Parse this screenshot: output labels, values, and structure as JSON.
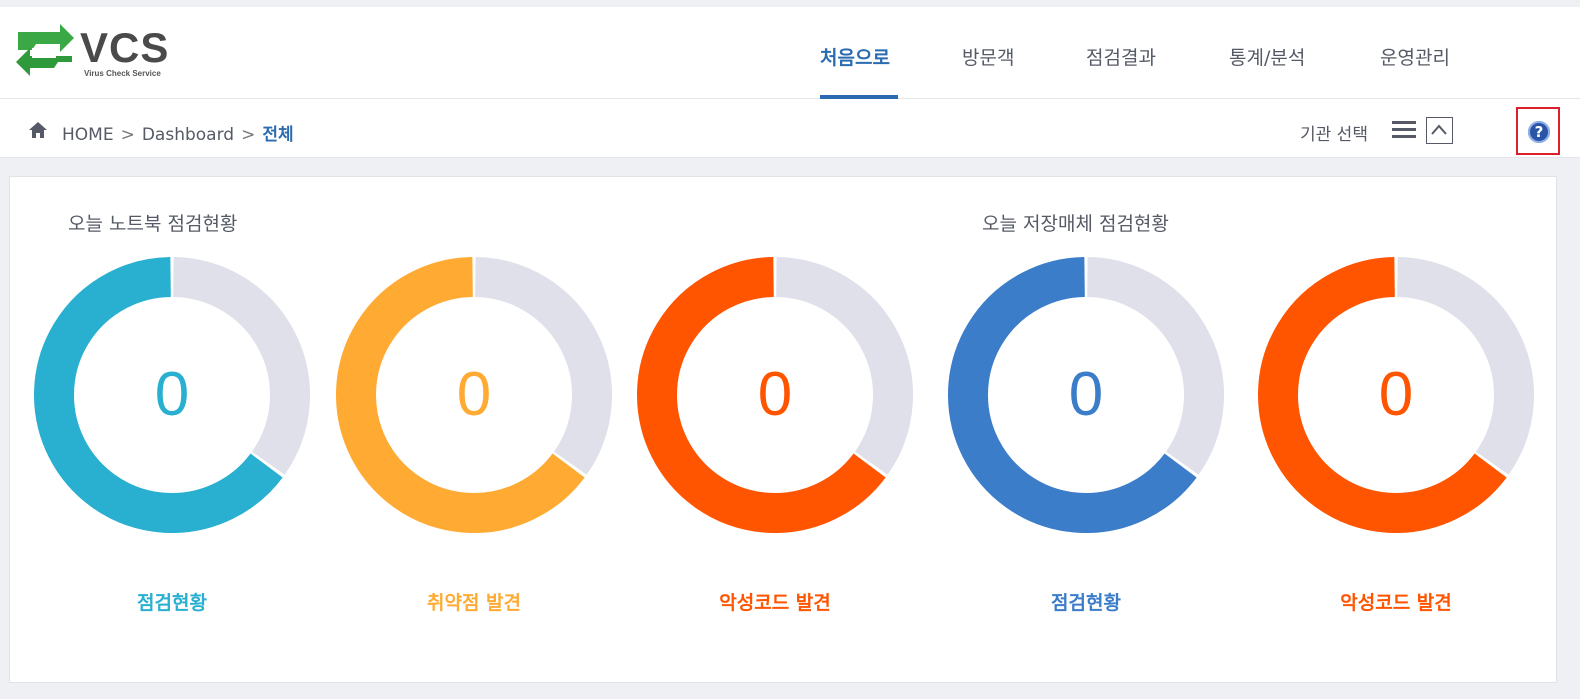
{
  "app": {
    "logo_text": "VCS",
    "logo_subtitle": "Virus Check Service"
  },
  "nav": {
    "items": [
      {
        "label": "처음으로",
        "active": true
      },
      {
        "label": "방문객",
        "active": false
      },
      {
        "label": "점검결과",
        "active": false
      },
      {
        "label": "통계/분석",
        "active": false
      },
      {
        "label": "운영관리",
        "active": false
      }
    ]
  },
  "breadcrumb": {
    "home": "HOME",
    "separator": ">",
    "level1": "Dashboard",
    "current": "전체"
  },
  "toolbar": {
    "org_select_label": "기관 선택",
    "help_symbol": "?"
  },
  "sections": {
    "laptop_title": "오늘 노트북 점검현황",
    "storage_title": "오늘 저장매체 점검현황"
  },
  "donuts": [
    {
      "value": "0",
      "label": "점검현황",
      "color": "#29afd0",
      "fill_fraction": 0.65
    },
    {
      "value": "0",
      "label": "취약점 발견",
      "color": "#ffaa33",
      "fill_fraction": 0.65
    },
    {
      "value": "0",
      "label": "악성코드 발견",
      "color": "#ff5500",
      "fill_fraction": 0.65
    },
    {
      "value": "0",
      "label": "점검현황",
      "color": "#3c7dca",
      "fill_fraction": 0.65
    },
    {
      "value": "0",
      "label": "악성코드 발견",
      "color": "#ff5500",
      "fill_fraction": 0.65
    }
  ],
  "colors": {
    "accent": "#2b6cb0",
    "track": "#dfe0ea",
    "help_border": "#d9202b"
  }
}
